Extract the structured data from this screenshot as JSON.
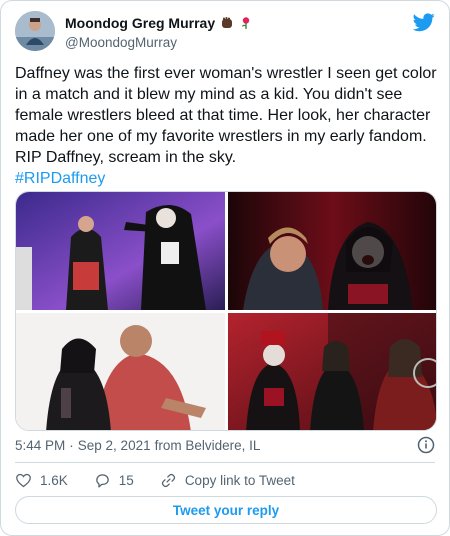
{
  "author": {
    "display_name": "Moondog Greg Murray",
    "handle": "@MoondogMurray",
    "emoji_icons": [
      "raised-fist-icon",
      "rose-icon"
    ]
  },
  "tweet": {
    "text": "Daffney was the first ever woman's wrestler I seen get color in a match and it blew my mind as a kid. You didn't see female wrestlers bleed at that time. Her look, her character made her one of my favorite wrestlers in my early fandom. RIP Daffney, scream in the sky.",
    "hashtag": "#RIPDaffney"
  },
  "media": {
    "count": 4,
    "images": [
      "photo-wrestlers-ring-purple",
      "photo-daffney-screaming-red",
      "photo-daffney-hug-white",
      "photo-group-red-backdrop"
    ]
  },
  "meta": {
    "time": "5:44 PM",
    "separator": "·",
    "date": "Sep 2, 2021",
    "location": "from Belvidere, IL"
  },
  "actions": {
    "likes": "1.6K",
    "replies": "15",
    "copy_link": "Copy link to Tweet"
  },
  "reply_button": "Tweet your reply",
  "colors": {
    "accent": "#1d9bf0",
    "text": "#0f1419",
    "secondary": "#536471",
    "border": "#cfd9de"
  }
}
